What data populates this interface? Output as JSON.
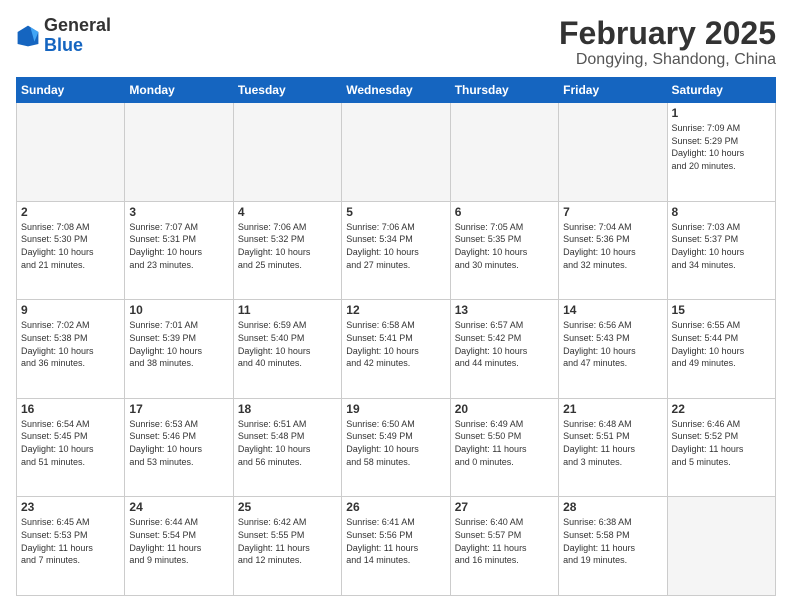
{
  "header": {
    "logo": {
      "general": "General",
      "blue": "Blue"
    },
    "title": "February 2025",
    "location": "Dongying, Shandong, China"
  },
  "days_of_week": [
    "Sunday",
    "Monday",
    "Tuesday",
    "Wednesday",
    "Thursday",
    "Friday",
    "Saturday"
  ],
  "weeks": [
    [
      {
        "day": "",
        "info": ""
      },
      {
        "day": "",
        "info": ""
      },
      {
        "day": "",
        "info": ""
      },
      {
        "day": "",
        "info": ""
      },
      {
        "day": "",
        "info": ""
      },
      {
        "day": "",
        "info": ""
      },
      {
        "day": "1",
        "info": "Sunrise: 7:09 AM\nSunset: 5:29 PM\nDaylight: 10 hours\nand 20 minutes."
      }
    ],
    [
      {
        "day": "2",
        "info": "Sunrise: 7:08 AM\nSunset: 5:30 PM\nDaylight: 10 hours\nand 21 minutes."
      },
      {
        "day": "3",
        "info": "Sunrise: 7:07 AM\nSunset: 5:31 PM\nDaylight: 10 hours\nand 23 minutes."
      },
      {
        "day": "4",
        "info": "Sunrise: 7:06 AM\nSunset: 5:32 PM\nDaylight: 10 hours\nand 25 minutes."
      },
      {
        "day": "5",
        "info": "Sunrise: 7:06 AM\nSunset: 5:34 PM\nDaylight: 10 hours\nand 27 minutes."
      },
      {
        "day": "6",
        "info": "Sunrise: 7:05 AM\nSunset: 5:35 PM\nDaylight: 10 hours\nand 30 minutes."
      },
      {
        "day": "7",
        "info": "Sunrise: 7:04 AM\nSunset: 5:36 PM\nDaylight: 10 hours\nand 32 minutes."
      },
      {
        "day": "8",
        "info": "Sunrise: 7:03 AM\nSunset: 5:37 PM\nDaylight: 10 hours\nand 34 minutes."
      }
    ],
    [
      {
        "day": "9",
        "info": "Sunrise: 7:02 AM\nSunset: 5:38 PM\nDaylight: 10 hours\nand 36 minutes."
      },
      {
        "day": "10",
        "info": "Sunrise: 7:01 AM\nSunset: 5:39 PM\nDaylight: 10 hours\nand 38 minutes."
      },
      {
        "day": "11",
        "info": "Sunrise: 6:59 AM\nSunset: 5:40 PM\nDaylight: 10 hours\nand 40 minutes."
      },
      {
        "day": "12",
        "info": "Sunrise: 6:58 AM\nSunset: 5:41 PM\nDaylight: 10 hours\nand 42 minutes."
      },
      {
        "day": "13",
        "info": "Sunrise: 6:57 AM\nSunset: 5:42 PM\nDaylight: 10 hours\nand 44 minutes."
      },
      {
        "day": "14",
        "info": "Sunrise: 6:56 AM\nSunset: 5:43 PM\nDaylight: 10 hours\nand 47 minutes."
      },
      {
        "day": "15",
        "info": "Sunrise: 6:55 AM\nSunset: 5:44 PM\nDaylight: 10 hours\nand 49 minutes."
      }
    ],
    [
      {
        "day": "16",
        "info": "Sunrise: 6:54 AM\nSunset: 5:45 PM\nDaylight: 10 hours\nand 51 minutes."
      },
      {
        "day": "17",
        "info": "Sunrise: 6:53 AM\nSunset: 5:46 PM\nDaylight: 10 hours\nand 53 minutes."
      },
      {
        "day": "18",
        "info": "Sunrise: 6:51 AM\nSunset: 5:48 PM\nDaylight: 10 hours\nand 56 minutes."
      },
      {
        "day": "19",
        "info": "Sunrise: 6:50 AM\nSunset: 5:49 PM\nDaylight: 10 hours\nand 58 minutes."
      },
      {
        "day": "20",
        "info": "Sunrise: 6:49 AM\nSunset: 5:50 PM\nDaylight: 11 hours\nand 0 minutes."
      },
      {
        "day": "21",
        "info": "Sunrise: 6:48 AM\nSunset: 5:51 PM\nDaylight: 11 hours\nand 3 minutes."
      },
      {
        "day": "22",
        "info": "Sunrise: 6:46 AM\nSunset: 5:52 PM\nDaylight: 11 hours\nand 5 minutes."
      }
    ],
    [
      {
        "day": "23",
        "info": "Sunrise: 6:45 AM\nSunset: 5:53 PM\nDaylight: 11 hours\nand 7 minutes."
      },
      {
        "day": "24",
        "info": "Sunrise: 6:44 AM\nSunset: 5:54 PM\nDaylight: 11 hours\nand 9 minutes."
      },
      {
        "day": "25",
        "info": "Sunrise: 6:42 AM\nSunset: 5:55 PM\nDaylight: 11 hours\nand 12 minutes."
      },
      {
        "day": "26",
        "info": "Sunrise: 6:41 AM\nSunset: 5:56 PM\nDaylight: 11 hours\nand 14 minutes."
      },
      {
        "day": "27",
        "info": "Sunrise: 6:40 AM\nSunset: 5:57 PM\nDaylight: 11 hours\nand 16 minutes."
      },
      {
        "day": "28",
        "info": "Sunrise: 6:38 AM\nSunset: 5:58 PM\nDaylight: 11 hours\nand 19 minutes."
      },
      {
        "day": "",
        "info": ""
      }
    ]
  ]
}
